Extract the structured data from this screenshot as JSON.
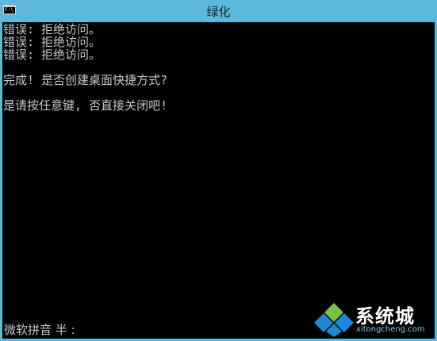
{
  "window": {
    "title": "绿化",
    "icon": "console-window-icon",
    "icon_text": "C:\\"
  },
  "console": {
    "lines": [
      "错误: 拒绝访问。",
      "错误: 拒绝访问。",
      "错误: 拒绝访问。",
      "",
      "完成! 是否创建桌面快捷方式?",
      "",
      "是请按任意键, 否直接关闭吧!"
    ]
  },
  "ime": {
    "label": "微软拼音 半 :"
  },
  "watermark": {
    "brand": "系统城",
    "domain": "xitongcheng.com",
    "colors": {
      "blue": "#1e88d8",
      "green": "#7cc242",
      "text": "#ffffff"
    }
  },
  "colors": {
    "titlebar": "#5cb8dd",
    "console_bg": "#000000",
    "console_text": "#c8c8c8"
  }
}
